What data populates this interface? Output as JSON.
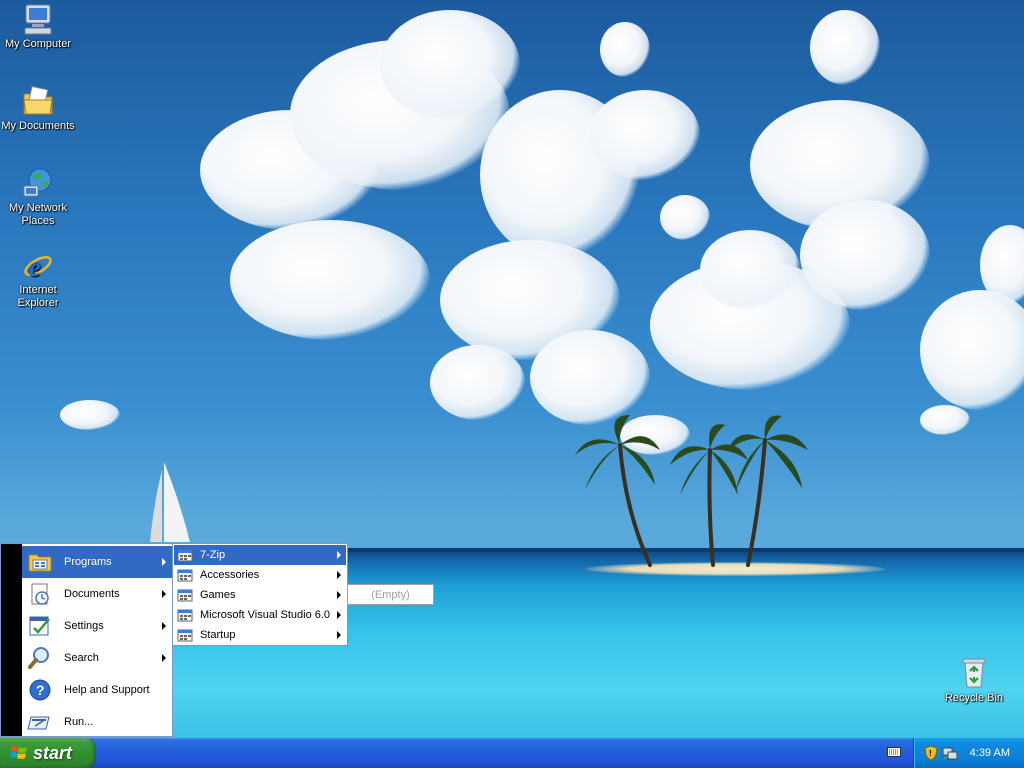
{
  "desktop": {
    "icons": [
      {
        "label": "My Computer",
        "icon": "my-computer-icon"
      },
      {
        "label": "My Documents",
        "icon": "my-documents-icon"
      },
      {
        "label": "My Network Places",
        "icon": "network-places-icon"
      },
      {
        "label": "Internet Explorer",
        "icon": "internet-explorer-icon"
      },
      {
        "label": "Recycle Bin",
        "icon": "recycle-bin-icon"
      }
    ]
  },
  "start_menu": {
    "items": [
      {
        "label": "Programs",
        "icon": "programs-icon",
        "has_submenu": true,
        "active": true
      },
      {
        "label": "Documents",
        "icon": "documents-icon",
        "has_submenu": true
      },
      {
        "label": "Settings",
        "icon": "settings-icon",
        "has_submenu": true
      },
      {
        "label": "Search",
        "icon": "search-icon",
        "has_submenu": true
      },
      {
        "label": "Help and Support",
        "icon": "help-icon",
        "has_submenu": false
      },
      {
        "label": "Run...",
        "icon": "run-icon",
        "has_submenu": false
      }
    ]
  },
  "programs_menu": {
    "items": [
      {
        "label": "7-Zip",
        "active": true
      },
      {
        "label": "Accessories"
      },
      {
        "label": "Games"
      },
      {
        "label": "Microsoft Visual Studio 6.0"
      },
      {
        "label": "Startup"
      }
    ]
  },
  "submenu_7zip": {
    "empty_label": "(Empty)"
  },
  "taskbar": {
    "start_label": "start",
    "clock": "4:39 AM"
  },
  "colors": {
    "highlight": "#316ac5",
    "taskbar_blue": "#245edb",
    "start_green": "#3c9b3c",
    "tray_blue": "#0b7fd6"
  }
}
